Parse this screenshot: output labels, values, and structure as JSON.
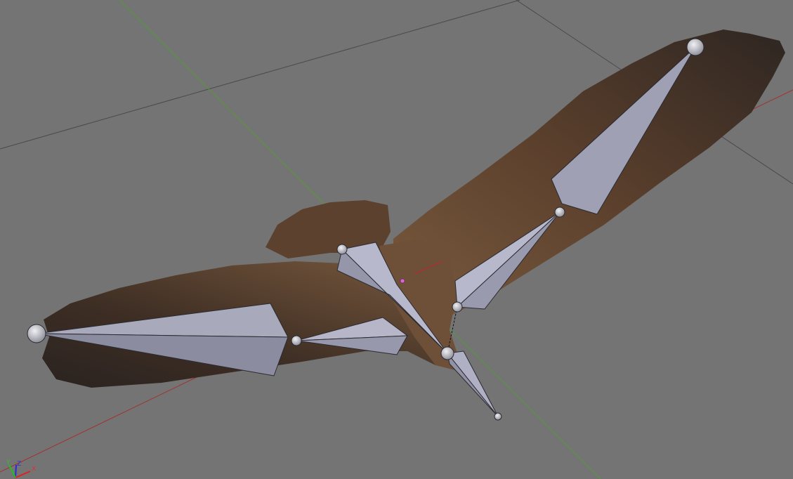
{
  "viewport": {
    "type": "3d-viewport",
    "background_color": "#747474",
    "object": "eagle-armature",
    "colors": {
      "x_axis": "#a33030",
      "y_axis": "#4f9a3a",
      "grid": "#4a4a4a",
      "bone": "#b4b4c8",
      "feather": "#4a3426"
    }
  },
  "axis_gizmo": {
    "x_label": "X",
    "y_label": "Y",
    "z_label": "Z"
  }
}
